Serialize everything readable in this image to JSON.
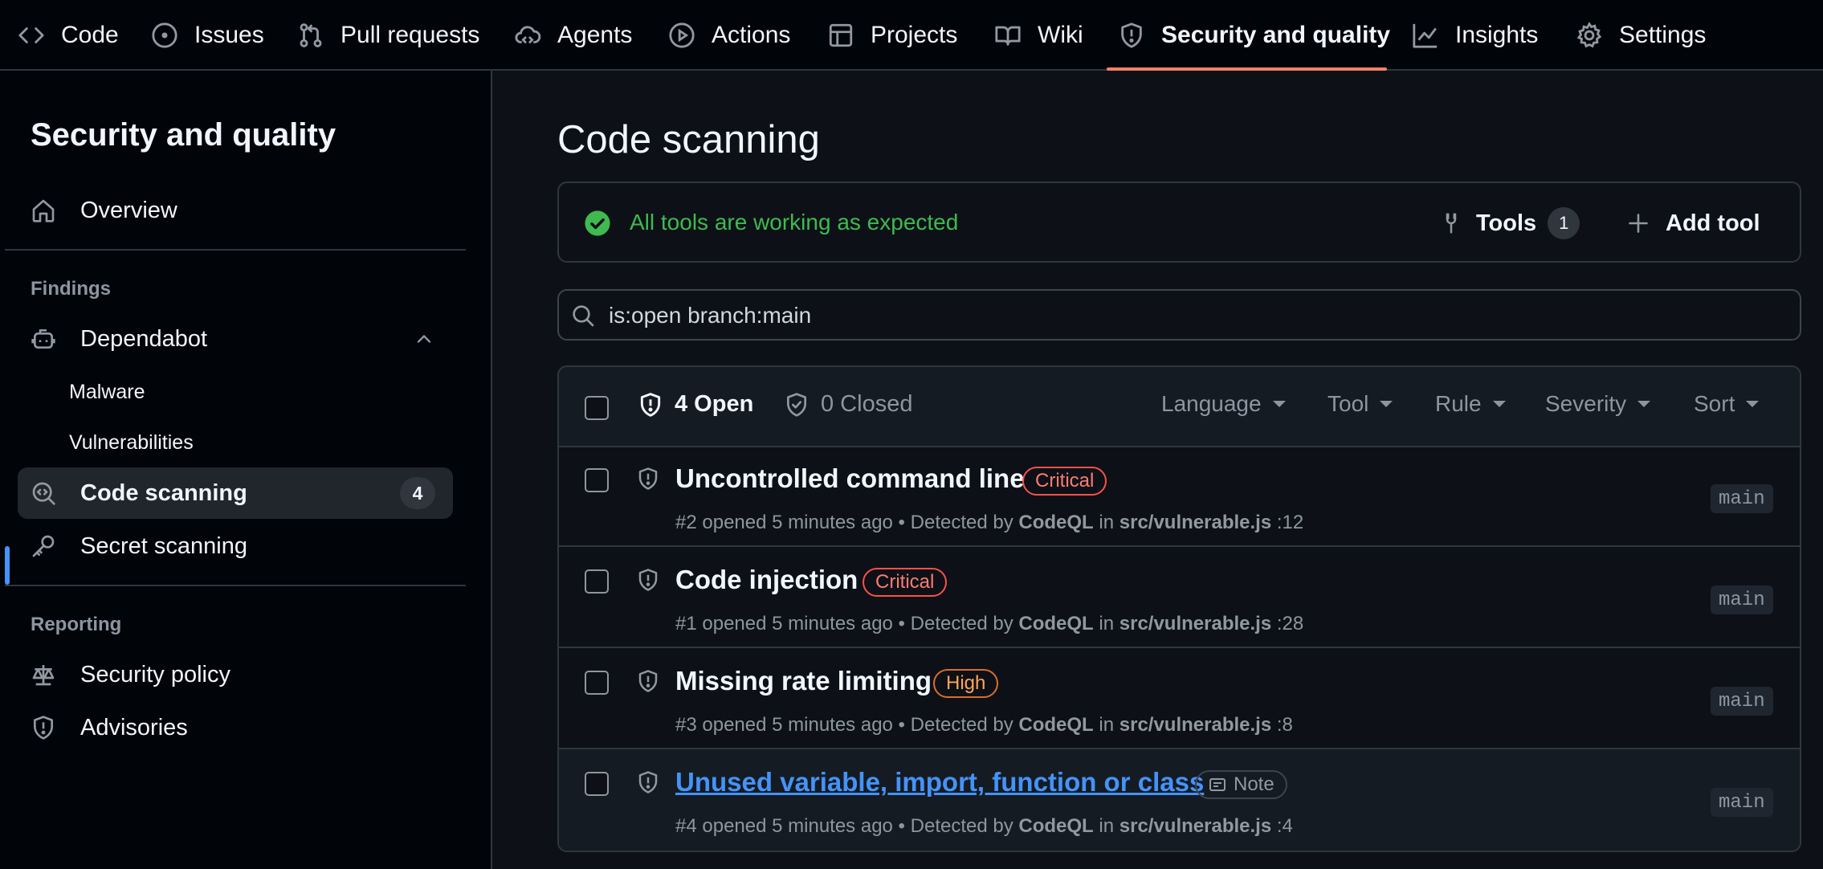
{
  "topnav": {
    "tabs": [
      {
        "label": "Code",
        "icon": "code-icon"
      },
      {
        "label": "Issues",
        "icon": "issue-opened-icon"
      },
      {
        "label": "Pull requests",
        "icon": "git-pull-request-icon"
      },
      {
        "label": "Agents",
        "icon": "agent-icon"
      },
      {
        "label": "Actions",
        "icon": "play-icon"
      },
      {
        "label": "Projects",
        "icon": "table-icon"
      },
      {
        "label": "Wiki",
        "icon": "book-icon"
      },
      {
        "label": "Security and quality",
        "icon": "shield-icon",
        "active": true
      },
      {
        "label": "Insights",
        "icon": "graph-icon"
      },
      {
        "label": "Settings",
        "icon": "gear-icon"
      }
    ]
  },
  "sidebar": {
    "title": "Security and quality",
    "overview": "Overview",
    "findings_heading": "Findings",
    "dependabot": "Dependabot",
    "malware": "Malware",
    "vulnerabilities": "Vulnerabilities",
    "code_scanning": "Code scanning",
    "code_scanning_count": "4",
    "secret_scanning": "Secret scanning",
    "reporting_heading": "Reporting",
    "security_policy": "Security policy",
    "advisories": "Advisories"
  },
  "main": {
    "title": "Code scanning",
    "status_text": "All tools are working as expected",
    "tools_label": "Tools",
    "tools_count": "1",
    "add_tool_label": "Add tool",
    "search_value": "is:open branch:main",
    "open_label": "4 Open",
    "closed_label": "0 Closed",
    "filters": [
      "Language",
      "Tool",
      "Rule",
      "Severity",
      "Sort"
    ],
    "alerts": [
      {
        "title": "Uncontrolled command line",
        "severity": "Critical",
        "severity_kind": "crit",
        "number": "#2",
        "opened": "opened 5 minutes ago",
        "detected": "Detected by",
        "tool": "CodeQL",
        "in": "in",
        "file": "src/vulnerable.js",
        "line": ":12",
        "branch": "main"
      },
      {
        "title": "Code injection",
        "severity": "Critical",
        "severity_kind": "crit",
        "number": "#1",
        "opened": "opened 5 minutes ago",
        "detected": "Detected by",
        "tool": "CodeQL",
        "in": "in",
        "file": "src/vulnerable.js",
        "line": ":28",
        "branch": "main"
      },
      {
        "title": "Missing rate limiting",
        "severity": "High",
        "severity_kind": "high",
        "number": "#3",
        "opened": "opened 5 minutes ago",
        "detected": "Detected by",
        "tool": "CodeQL",
        "in": "in",
        "file": "src/vulnerable.js",
        "line": ":8",
        "branch": "main"
      },
      {
        "title": "Unused variable, import, function or class",
        "severity": "Note",
        "severity_kind": "note",
        "number": "#4",
        "opened": "opened 5 minutes ago",
        "detected": "Detected by",
        "tool": "CodeQL",
        "in": "in",
        "file": "src/vulnerable.js",
        "line": ":4",
        "branch": "main"
      }
    ]
  },
  "colors": {
    "background": "#0d1117",
    "accent_tab": "#f78166",
    "link": "#4493f8",
    "success": "#3fb950",
    "critical": "#f85149",
    "high": "#db6d28"
  }
}
